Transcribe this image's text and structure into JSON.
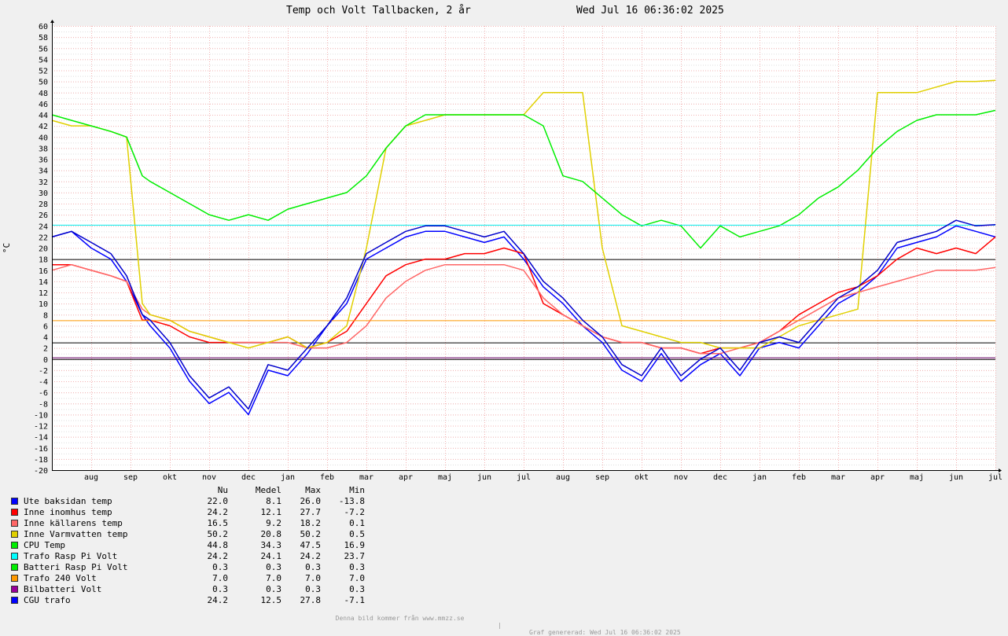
{
  "title": "Temp och Volt Tallbacken, 2 år",
  "timestamp": "Wed Jul 16 06:36:02 2025",
  "chart_data": {
    "type": "line",
    "ylabel": "°C",
    "ylim": [
      -20,
      60
    ],
    "y_ticks": [
      -20,
      -18,
      -16,
      -14,
      -12,
      -10,
      -8,
      -6,
      -4,
      -2,
      0,
      2,
      4,
      6,
      8,
      10,
      12,
      14,
      16,
      18,
      20,
      22,
      24,
      26,
      28,
      30,
      32,
      34,
      36,
      38,
      40,
      42,
      44,
      46,
      48,
      50,
      52,
      54,
      56,
      58,
      60
    ],
    "x_range_months": [
      0,
      24
    ],
    "x_tick_labels": [
      "aug",
      "sep",
      "okt",
      "nov",
      "dec",
      "jan",
      "feb",
      "mar",
      "apr",
      "maj",
      "jun",
      "jul",
      "aug",
      "sep",
      "okt",
      "nov",
      "dec",
      "jan",
      "feb",
      "mar",
      "apr",
      "maj",
      "jun",
      "jul"
    ],
    "grid": true,
    "legend_position": "bottom-left",
    "legend_headers": [
      "Nu",
      "Medel",
      "Max",
      "Min"
    ],
    "x": [
      0.0,
      0.5,
      1.0,
      1.5,
      1.9,
      2.3,
      2.5,
      3.0,
      3.5,
      4.0,
      4.5,
      5.0,
      5.5,
      6.0,
      6.5,
      7.0,
      7.5,
      8.0,
      8.5,
      9.0,
      9.5,
      10.0,
      10.5,
      11.0,
      11.5,
      12.0,
      12.5,
      13.0,
      13.5,
      14.0,
      14.5,
      15.0,
      15.5,
      16.0,
      16.5,
      17.0,
      17.5,
      18.0,
      18.5,
      19.0,
      19.5,
      20.0,
      20.5,
      21.0,
      21.5,
      22.0,
      22.5,
      23.0,
      23.5,
      24.0
    ],
    "series": [
      {
        "name": "Ute baksidan temp",
        "color": "#0000ff",
        "values": [
          22,
          23,
          20,
          18,
          14,
          8,
          6,
          2,
          -4,
          -8,
          -6,
          -10,
          -2,
          -3,
          1,
          6,
          10,
          18,
          20,
          22,
          23,
          23,
          22,
          21,
          22,
          18,
          13,
          10,
          6,
          3,
          -2,
          -4,
          1,
          -4,
          -1,
          1,
          -3,
          2,
          3,
          2,
          6,
          10,
          12,
          15,
          20,
          21,
          22,
          24,
          23,
          22
        ]
      },
      {
        "name": "Inne inomhus temp",
        "color": "#ff0000",
        "values": [
          17,
          17,
          16,
          15,
          14,
          7,
          7,
          6,
          4,
          3,
          3,
          3,
          3,
          4,
          2,
          3,
          5,
          10,
          15,
          17,
          18,
          18,
          19,
          19,
          20,
          19,
          10,
          8,
          6,
          4,
          3,
          3,
          2,
          2,
          1,
          2,
          2,
          3,
          5,
          8,
          10,
          12,
          13,
          15,
          18,
          20,
          19,
          20,
          19,
          22
        ]
      },
      {
        "name": "Inne källarens temp",
        "color": "#ff6666",
        "values": [
          16,
          17,
          16,
          15,
          14,
          9,
          8,
          7,
          5,
          4,
          3,
          3,
          3,
          3,
          2,
          2,
          3,
          6,
          11,
          14,
          16,
          17,
          17,
          17,
          17,
          16,
          11,
          8,
          6,
          4,
          3,
          3,
          2,
          2,
          1,
          1,
          2,
          3,
          5,
          7,
          9,
          11,
          12,
          13,
          14,
          15,
          16,
          16,
          16,
          16.5
        ]
      },
      {
        "name": "Inne Varmvatten temp",
        "color": "#e0d000",
        "values": [
          43,
          42,
          42,
          41,
          40,
          10,
          8,
          7,
          5,
          4,
          3,
          2,
          3,
          4,
          2,
          3,
          6,
          20,
          38,
          42,
          43,
          44,
          44,
          44,
          44,
          44,
          48,
          48,
          48,
          20,
          6,
          5,
          4,
          3,
          3,
          2,
          2,
          2,
          4,
          6,
          7,
          8,
          9,
          48,
          48,
          48,
          49,
          50,
          50,
          50.2
        ]
      },
      {
        "name": "CPU Temp",
        "color": "#00ee00",
        "values": [
          44,
          43,
          42,
          41,
          40,
          33,
          32,
          30,
          28,
          26,
          25,
          26,
          25,
          27,
          28,
          29,
          30,
          33,
          38,
          42,
          44,
          44,
          44,
          44,
          44,
          44,
          42,
          33,
          32,
          29,
          26,
          24,
          25,
          24,
          20,
          24,
          22,
          23,
          24,
          26,
          29,
          31,
          34,
          38,
          41,
          43,
          44,
          44,
          44,
          44.8
        ]
      },
      {
        "name": "Trafo Rasp Pi Volt",
        "color": "#00eeee",
        "constant": 24.2
      },
      {
        "name": "Batteri Rasp Pi Volt",
        "color": "#00ee00",
        "constant": 0.3
      },
      {
        "name": "Trafo 240 Volt",
        "color": "#ff9900",
        "constant": 7.0
      },
      {
        "name": "Bilbatteri Volt",
        "color": "#990099",
        "constant": 0.3
      },
      {
        "name": "CGU trafo",
        "color": "#0000cc",
        "values": [
          22,
          23,
          21,
          19,
          15,
          8,
          7,
          3,
          -3,
          -7,
          -5,
          -9,
          -1,
          -2,
          2,
          6,
          11,
          19,
          21,
          23,
          24,
          24,
          23,
          22,
          23,
          19,
          14,
          11,
          7,
          4,
          -1,
          -3,
          2,
          -3,
          0,
          2,
          -2,
          3,
          4,
          3,
          7,
          11,
          13,
          16,
          21,
          22,
          23,
          25,
          24,
          24.2
        ]
      }
    ],
    "horizontal_lines": [
      18,
      3,
      0
    ]
  },
  "legend": [
    {
      "name": "Ute baksidan temp",
      "color": "#0000ff",
      "nu": "22.0",
      "medel": "8.1",
      "max": "26.0",
      "min": "-13.8"
    },
    {
      "name": "Inne inomhus temp",
      "color": "#ff0000",
      "nu": "24.2",
      "medel": "12.1",
      "max": "27.7",
      "min": "-7.2"
    },
    {
      "name": "Inne källarens temp",
      "color": "#ff6666",
      "nu": "16.5",
      "medel": "9.2",
      "max": "18.2",
      "min": "0.1"
    },
    {
      "name": "Inne Varmvatten temp",
      "color": "#e0d000",
      "nu": "50.2",
      "medel": "20.8",
      "max": "50.2",
      "min": "0.5"
    },
    {
      "name": "CPU Temp",
      "color": "#00ee00",
      "nu": "44.8",
      "medel": "34.3",
      "max": "47.5",
      "min": "16.9"
    },
    {
      "name": "Trafo Rasp Pi Volt",
      "color": "#00ffff",
      "nu": "24.2",
      "medel": "24.1",
      "max": "24.2",
      "min": "23.7"
    },
    {
      "name": "Batteri Rasp Pi Volt",
      "color": "#00ee00",
      "nu": "0.3",
      "medel": "0.3",
      "max": "0.3",
      "min": "0.3"
    },
    {
      "name": "Trafo 240 Volt",
      "color": "#ff9900",
      "nu": "7.0",
      "medel": "7.0",
      "max": "7.0",
      "min": "7.0"
    },
    {
      "name": "Bilbatteri Volt",
      "color": "#990099",
      "nu": "0.3",
      "medel": "0.3",
      "max": "0.3",
      "min": "0.3"
    },
    {
      "name": "CGU trafo",
      "color": "#0000ff",
      "nu": "24.2",
      "medel": "12.5",
      "max": "27.8",
      "min": "-7.1"
    }
  ],
  "footer": {
    "left": "Denna bild kommer från www.mmzz.se",
    "sep": "|",
    "right": "Graf genererad: Wed Jul 16 06:36:02 2025"
  }
}
